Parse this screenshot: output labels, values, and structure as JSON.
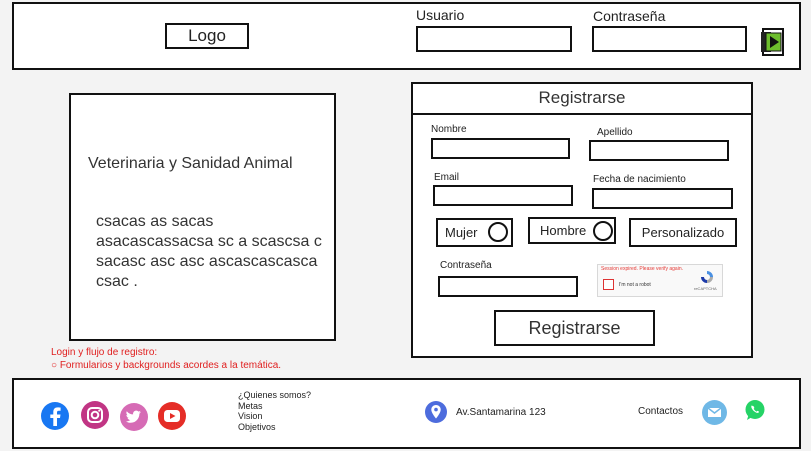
{
  "header": {
    "logo": "Logo",
    "user_label": "Usuario",
    "pass_label": "Contraseña",
    "user_value": "",
    "pass_value": ""
  },
  "intro": {
    "title": "Veterinaria y Sanidad Animal",
    "body": "csacas as sacas asacascassacsa sc a scascsa c sacasc asc asc ascascascasca csac ."
  },
  "note": {
    "line1": "Login y flujo de registro:",
    "line2": "○ Formularios y backgrounds acordes a la temática."
  },
  "form": {
    "title": "Registrarse",
    "nombre": "Nombre",
    "apellido": "Apellido",
    "email": "Email",
    "fecha": "Fecha de nacimiento",
    "gender": {
      "mujer": "Mujer",
      "hombre": "Hombre",
      "personalizado": "Personalizado"
    },
    "password": "Contraseña",
    "captcha": {
      "expired": "Session expired. Please verify again.",
      "label": "I'm not a robot",
      "brand": "reCAPTCHA"
    },
    "submit": "Registrarse"
  },
  "footer": {
    "links": [
      "¿Quienes somos?",
      "Metas",
      "Vision",
      "Objetivos"
    ],
    "address": "Av.Santamarina 123",
    "contact": "Contactos"
  },
  "icons": {
    "facebook": "facebook-icon",
    "instagram": "instagram-icon",
    "twitter": "twitter-icon",
    "youtube": "youtube-icon",
    "location": "location-pin-icon",
    "mail": "mail-icon",
    "whatsapp": "whatsapp-icon",
    "login": "login-arrow-icon"
  },
  "colors": {
    "facebook": "#1877f2",
    "instagram": "#c13584",
    "twitter": "#d66bb5",
    "youtube": "#e52d27",
    "location": "#4d6cdd",
    "mail": "#6fb8e6",
    "whatsapp": "#25d366",
    "note": "#e02020"
  }
}
